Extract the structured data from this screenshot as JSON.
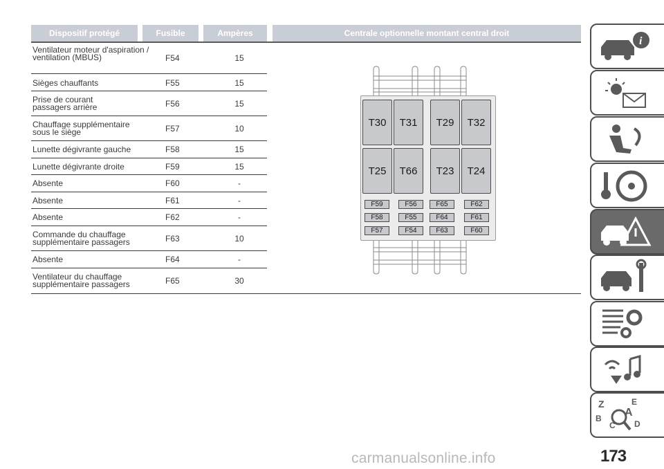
{
  "table": {
    "headers": {
      "device": "Dispositif protégé",
      "fuse": "Fusible",
      "amperes": "Ampères",
      "panel": "Centrale optionnelle montant central droit"
    },
    "rows": [
      {
        "device": "Ventilateur moteur d'aspiration / ventilation (MBUS)",
        "fuse": "F54",
        "amps": "15"
      },
      {
        "device": "Sièges chauffants",
        "fuse": "F55",
        "amps": "15"
      },
      {
        "device": "Prise de courant passagers arrière",
        "fuse": "F56",
        "amps": "15"
      },
      {
        "device": "Chauffage supplémentaire sous le siège",
        "fuse": "F57",
        "amps": "10"
      },
      {
        "device": "Lunette dégivrante gauche",
        "fuse": "F58",
        "amps": "15"
      },
      {
        "device": "Lunette dégivrante droite",
        "fuse": "F59",
        "amps": "15"
      },
      {
        "device": "Absente",
        "fuse": "F60",
        "amps": "-"
      },
      {
        "device": "Absente",
        "fuse": "F61",
        "amps": "-"
      },
      {
        "device": "Absente",
        "fuse": "F62",
        "amps": "-"
      },
      {
        "device": "Commande du chauffage supplémentaire passagers",
        "fuse": "F63",
        "amps": "10"
      },
      {
        "device": "Absente",
        "fuse": "F64",
        "amps": "-"
      },
      {
        "device": "Ventilateur du chauffage supplémentaire passagers",
        "fuse": "F65",
        "amps": "30"
      }
    ]
  },
  "diagram": {
    "relays": [
      "T30",
      "T31",
      "T29",
      "T32",
      "T25",
      "T66",
      "T23",
      "T24"
    ],
    "fuses": [
      "F59",
      "F56",
      "F65",
      "F62",
      "F58",
      "F55",
      "F64",
      "F61",
      "F57",
      "F54",
      "F63",
      "F60"
    ]
  },
  "side_tabs": [
    {
      "icon": "car-info-icon"
    },
    {
      "icon": "warning-lights-icon"
    },
    {
      "icon": "seat-airbag-icon"
    },
    {
      "icon": "steering-key-icon"
    },
    {
      "icon": "car-breakdown-icon",
      "active": true
    },
    {
      "icon": "car-maintenance-icon"
    },
    {
      "icon": "specifications-gear-icon"
    },
    {
      "icon": "multimedia-icon"
    },
    {
      "icon": "alphabetical-index-icon"
    }
  ],
  "page_number": "173",
  "watermark": "carmanualsonline.info",
  "colors": {
    "header_bg": "#c9ced6",
    "active_tab": "#6a6a6a",
    "relay": "#c7c9cc"
  }
}
